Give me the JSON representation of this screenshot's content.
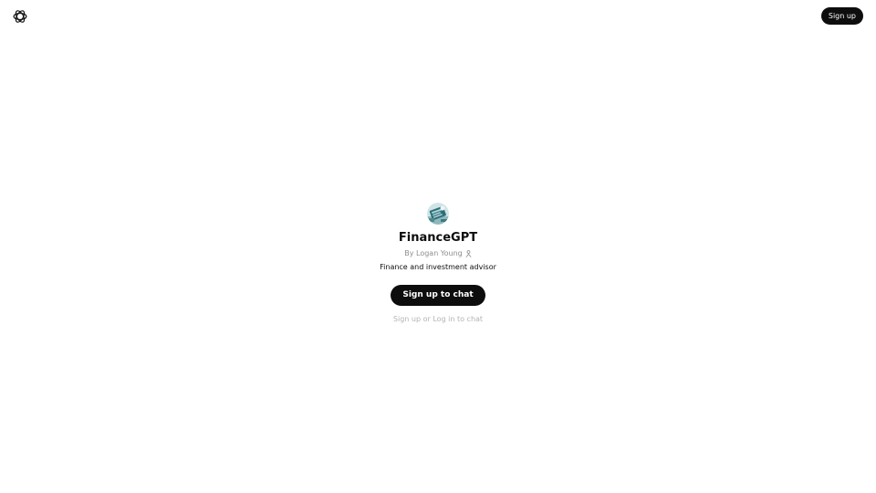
{
  "header": {
    "logo_icon": "openai-logo-icon",
    "signup_label": "Sign up"
  },
  "gpt": {
    "avatar_icon": "finance-avatar-icon",
    "name": "FinanceGPT",
    "author": "By Logan Young",
    "author_icon": "person-icon",
    "description": "Finance and investment advisor"
  },
  "actions": {
    "cta_label": "Sign up to chat",
    "hint": "Sign up or Log in to chat"
  },
  "colors": {
    "primary": "#0d0d0d",
    "muted": "#8e8e8e",
    "hint": "#b4b4b4",
    "background": "#ffffff"
  }
}
